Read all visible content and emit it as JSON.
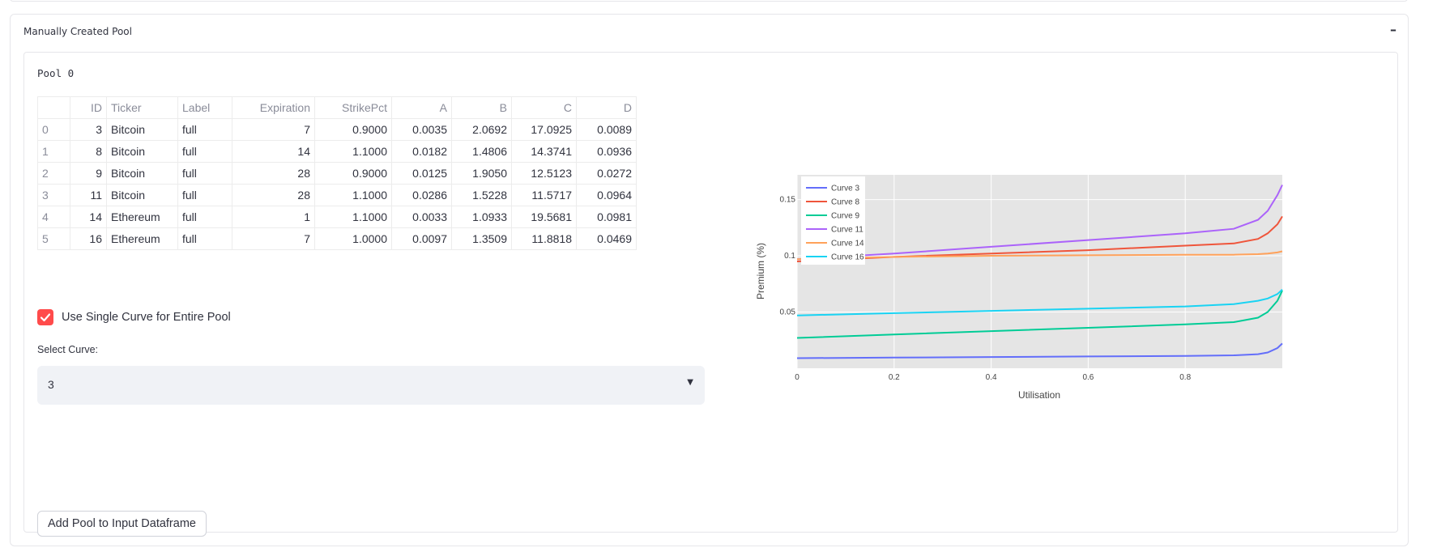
{
  "expander": {
    "title": "Manually Created Pool",
    "toggle": "–"
  },
  "pool": {
    "label": "Pool 0",
    "table": {
      "headers": [
        "",
        "ID",
        "Ticker",
        "Label",
        "Expiration",
        "StrikePct",
        "A",
        "B",
        "C",
        "D"
      ],
      "rows": [
        [
          "0",
          "3",
          "Bitcoin",
          "full",
          "7",
          "0.9000",
          "0.0035",
          "2.0692",
          "17.0925",
          "0.0089"
        ],
        [
          "1",
          "8",
          "Bitcoin",
          "full",
          "14",
          "1.1000",
          "0.0182",
          "1.4806",
          "14.3741",
          "0.0936"
        ],
        [
          "2",
          "9",
          "Bitcoin",
          "full",
          "28",
          "0.9000",
          "0.0125",
          "1.9050",
          "12.5123",
          "0.0272"
        ],
        [
          "3",
          "11",
          "Bitcoin",
          "full",
          "28",
          "1.1000",
          "0.0286",
          "1.5228",
          "11.5717",
          "0.0964"
        ],
        [
          "4",
          "14",
          "Ethereum",
          "full",
          "1",
          "1.1000",
          "0.0033",
          "1.0933",
          "19.5681",
          "0.0981"
        ],
        [
          "5",
          "16",
          "Ethereum",
          "full",
          "7",
          "1.0000",
          "0.0097",
          "1.3509",
          "11.8818",
          "0.0469"
        ]
      ]
    }
  },
  "checkbox": {
    "label": "Use Single Curve for Entire Pool",
    "checked": true
  },
  "select_curve": {
    "label": "Select Curve:",
    "value": "3"
  },
  "add_button": {
    "label": "Add Pool to Input Dataframe"
  },
  "colors": {
    "accent": "#ff4b4b"
  },
  "chart_data": {
    "type": "line",
    "title": "",
    "xlabel": "Utilisation",
    "ylabel": "Premium (%)",
    "xlim": [
      0,
      1
    ],
    "ylim": [
      0,
      0.172
    ],
    "xticks": [
      0,
      0.2,
      0.4,
      0.6,
      0.8
    ],
    "yticks": [
      0.05,
      0.1,
      0.15
    ],
    "grid": true,
    "legend_position": "top-left",
    "series": [
      {
        "name": "Curve 3",
        "color": "#636efa",
        "x": [
          0,
          0.2,
          0.4,
          0.6,
          0.8,
          0.9,
          0.95,
          0.97,
          0.99,
          1.0
        ],
        "y": [
          0.009,
          0.0095,
          0.01,
          0.0105,
          0.011,
          0.0115,
          0.0125,
          0.014,
          0.018,
          0.022
        ]
      },
      {
        "name": "Curve 8",
        "color": "#ef553b",
        "x": [
          0,
          0.2,
          0.4,
          0.6,
          0.8,
          0.9,
          0.95,
          0.97,
          0.99,
          1.0
        ],
        "y": [
          0.095,
          0.099,
          0.102,
          0.105,
          0.109,
          0.111,
          0.115,
          0.12,
          0.128,
          0.135
        ]
      },
      {
        "name": "Curve 9",
        "color": "#00cc96",
        "x": [
          0,
          0.2,
          0.4,
          0.6,
          0.8,
          0.9,
          0.95,
          0.97,
          0.99,
          1.0
        ],
        "y": [
          0.027,
          0.03,
          0.033,
          0.036,
          0.039,
          0.041,
          0.045,
          0.05,
          0.06,
          0.069
        ]
      },
      {
        "name": "Curve 11",
        "color": "#ab63fa",
        "x": [
          0,
          0.2,
          0.4,
          0.6,
          0.8,
          0.9,
          0.95,
          0.97,
          0.99,
          1.0
        ],
        "y": [
          0.097,
          0.102,
          0.108,
          0.114,
          0.12,
          0.124,
          0.132,
          0.14,
          0.154,
          0.163
        ]
      },
      {
        "name": "Curve 14",
        "color": "#ffa15a",
        "x": [
          0,
          0.2,
          0.4,
          0.6,
          0.8,
          0.9,
          0.95,
          0.97,
          0.99,
          1.0
        ],
        "y": [
          0.097,
          0.099,
          0.1,
          0.1005,
          0.101,
          0.101,
          0.1015,
          0.102,
          0.103,
          0.104
        ]
      },
      {
        "name": "Curve 16",
        "color": "#19d3f3",
        "x": [
          0,
          0.2,
          0.4,
          0.6,
          0.8,
          0.9,
          0.95,
          0.97,
          0.99,
          1.0
        ],
        "y": [
          0.047,
          0.049,
          0.051,
          0.053,
          0.055,
          0.057,
          0.06,
          0.062,
          0.066,
          0.07
        ]
      }
    ]
  }
}
